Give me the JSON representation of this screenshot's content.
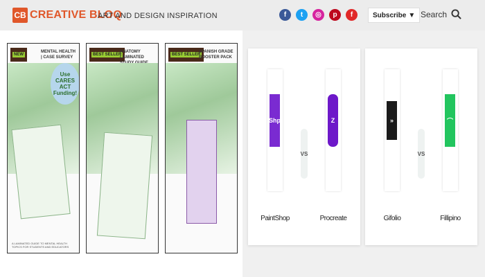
{
  "header": {
    "logo_mark": "CB",
    "logo_text": "CREATIVE BLOQ",
    "tagline": "ART AND DESIGN INSPIRATION",
    "socials": [
      {
        "name": "facebook-icon",
        "glyph": "f",
        "color": "#3b5998"
      },
      {
        "name": "twitter-icon",
        "glyph": "t",
        "color": "#1da1f2"
      },
      {
        "name": "instagram-icon",
        "glyph": "◎",
        "color": "#d6249f"
      },
      {
        "name": "pinterest-icon",
        "glyph": "p",
        "color": "#bd081c"
      },
      {
        "name": "flipboard-icon",
        "glyph": "f",
        "color": "#e12828"
      }
    ],
    "subscribe_label": "Subscribe",
    "subscribe_caret": "▼",
    "search_label": "Search"
  },
  "books": [
    {
      "tag": "NEW",
      "title": "MENTAL HEALTH | CASE SURVEY",
      "bubble": "Use CARES ACT Funding!",
      "fine": "A LAMINATED GUIDE TO MENTAL HEALTH TOPICS FOR STUDENTS AND EDUCATORS"
    },
    {
      "tag": "BEST SELLER",
      "title": "ANATOMY LAMINATED STUDY GUIDE",
      "bubble": "",
      "fine": ""
    },
    {
      "tag": "BEST SELLER",
      "title": "SPANISH GRADE BOOSTER PACK",
      "bubble": "",
      "fine": ""
    }
  ],
  "comparisons": [
    {
      "left": {
        "name": "PaintShop",
        "glyph": "Shp",
        "color": "#7a2bd1"
      },
      "vs": "VS",
      "right": {
        "name": "Procreate",
        "glyph": "Z",
        "color": "#6d18c9"
      }
    },
    {
      "left": {
        "name": "Gifolio",
        "glyph": "»",
        "color": "#1a1a1a"
      },
      "vs": "VS",
      "right": {
        "name": "Fillipino",
        "glyph": "⌒",
        "color": "#22c55e"
      }
    }
  ]
}
